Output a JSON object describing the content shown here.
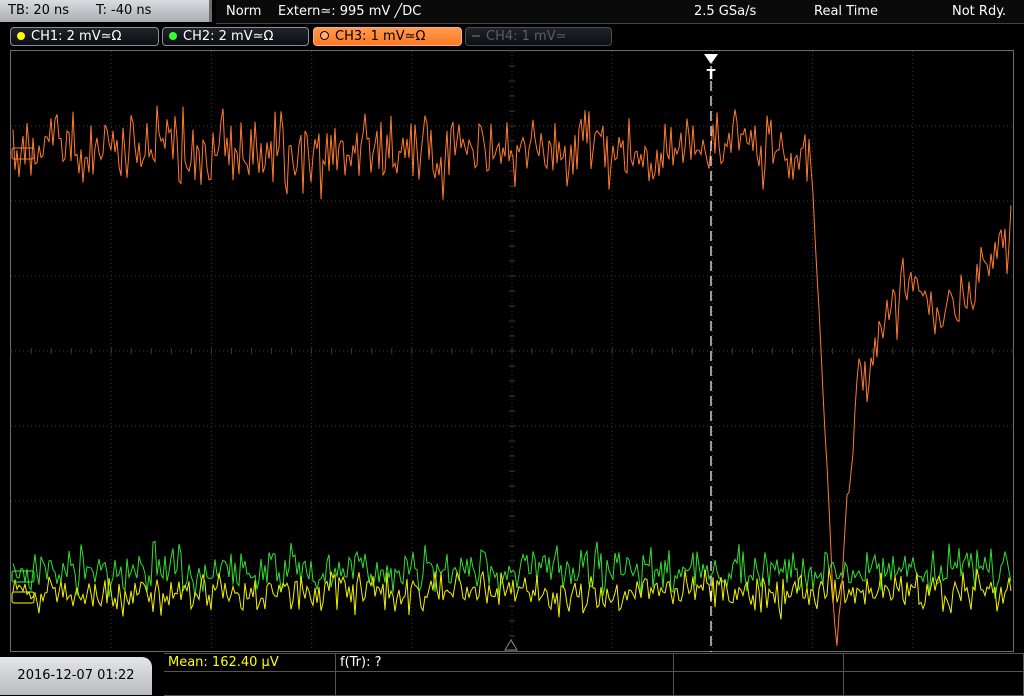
{
  "timebase": {
    "tb": "TB: 20 ns",
    "t": "T: -40 ns"
  },
  "status": {
    "mode": "Norm",
    "trigger": "Extern≃: 995 mV ╱DC",
    "sample_rate": "2.5 GSa/s",
    "acq": "Real Time",
    "state": "Not Rdy."
  },
  "channels": [
    {
      "label": "CH1: 2 mV≃Ω",
      "color": "#ffff00",
      "state": "on"
    },
    {
      "label": "CH2: 2 mV≃Ω",
      "color": "#33ff33",
      "state": "on"
    },
    {
      "label": "CH3: 1 mV≃Ω",
      "color": "#ff8030",
      "state": "active"
    },
    {
      "label": "CH4: 1 mV≃",
      "color": "#5b5e63",
      "state": "off"
    }
  ],
  "trigger_marker": "T",
  "datetime": "2016-12-07 01:22",
  "measurements": {
    "mean": "Mean: 162.40 µV",
    "ftr": "f(Tr): ?"
  },
  "colors": {
    "ch1": "#f2f200",
    "ch2": "#2fe02f",
    "ch3": "#ff7a2e",
    "grid": "#3a3a3a"
  }
}
